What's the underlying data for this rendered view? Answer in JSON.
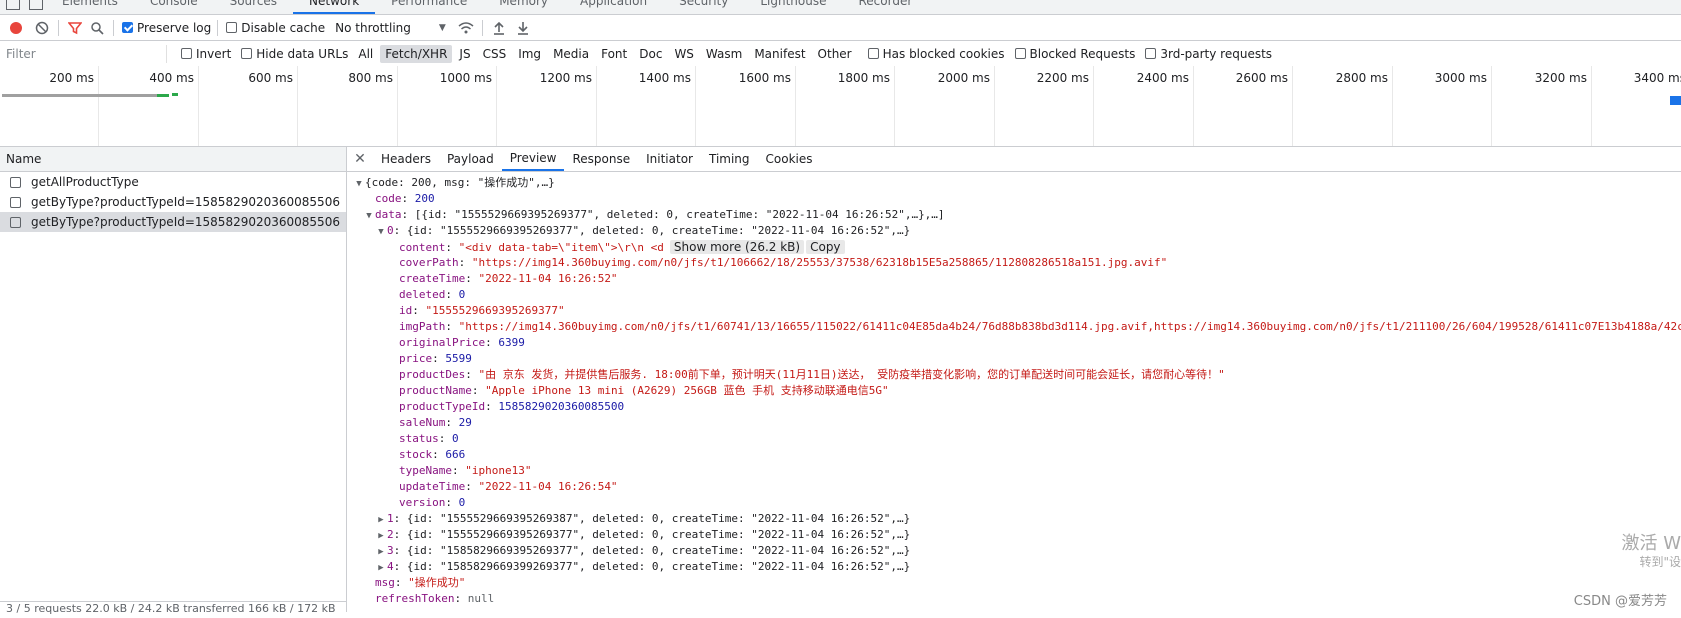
{
  "devtools": {
    "tabs": [
      "Elements",
      "Console",
      "Sources",
      "Network",
      "Performance",
      "Memory",
      "Application",
      "Security",
      "Lighthouse",
      "Recorder"
    ],
    "active_tab": "Network"
  },
  "toolbar": {
    "preserve_log": "Preserve log",
    "disable_cache": "Disable cache",
    "throttling": "No throttling"
  },
  "filter": {
    "placeholder": "Filter",
    "invert": "Invert",
    "hide_data_urls": "Hide data URLs",
    "types": [
      "All",
      "Fetch/XHR",
      "JS",
      "CSS",
      "Img",
      "Media",
      "Font",
      "Doc",
      "WS",
      "Wasm",
      "Manifest",
      "Other"
    ],
    "active_type": "Fetch/XHR",
    "has_blocked_cookies": "Has blocked cookies",
    "blocked_requests": "Blocked Requests",
    "third_party": "3rd-party requests"
  },
  "overview": {
    "ticks": [
      "200 ms",
      "400 ms",
      "600 ms",
      "800 ms",
      "1000 ms",
      "1200 ms",
      "1400 ms",
      "1600 ms",
      "1800 ms",
      "2000 ms",
      "2200 ms",
      "2400 ms",
      "2600 ms",
      "2800 ms",
      "3000 ms",
      "3200 ms",
      "3400 ms"
    ]
  },
  "requests": {
    "header": "Name",
    "items": [
      "getAllProductType",
      "getByType?productTypeId=1585829020360085506",
      "getByType?productTypeId=1585829020360085506"
    ],
    "selected_index": 2,
    "status": "3 / 5 requests   22.0 kB / 24.2 kB transferred   166 kB / 172 kB"
  },
  "detail": {
    "tabs": [
      "Headers",
      "Payload",
      "Preview",
      "Response",
      "Initiator",
      "Timing",
      "Cookies"
    ],
    "active": "Preview",
    "show_more": "Show more (26.2 kB)",
    "copy": "Copy"
  },
  "preview": {
    "root_summary": "{code: 200, msg: \"操作成功\",…}",
    "code_key": "code",
    "code_val": "200",
    "data_key": "data",
    "data_summary": "[{id: \"1555529669395269377\", deleted: 0, createTime: \"2022-11-04 16:26:52\",…},…]",
    "item0_key": "0",
    "item0_summary": "{id: \"1555529669395269377\", deleted: 0, createTime: \"2022-11-04 16:26:52\",…}",
    "fields": [
      {
        "key": "content",
        "val": "\"<div data-tab=\\\"item\\\">\\r\\n                    <d",
        "cls": "s"
      },
      {
        "key": "coverPath",
        "val": "\"https://img14.360buyimg.com/n0/jfs/t1/106662/18/25553/37538/62318b15E5a258865/112808286518a151.jpg.avif\"",
        "cls": "s"
      },
      {
        "key": "createTime",
        "val": "\"2022-11-04 16:26:52\"",
        "cls": "s"
      },
      {
        "key": "deleted",
        "val": "0",
        "cls": "n"
      },
      {
        "key": "id",
        "val": "\"1555529669395269377\"",
        "cls": "s"
      },
      {
        "key": "imgPath",
        "val": "\"https://img14.360buyimg.com/n0/jfs/t1/60741/13/16655/115022/61411c04E85da4b24/76d88b838bd3d114.jpg.avif,https://img14.360buyimg.com/n0/jfs/t1/211100/26/604/199528/61411c07E13b4188a/42c",
        "cls": "s"
      },
      {
        "key": "originalPrice",
        "val": "6399",
        "cls": "n"
      },
      {
        "key": "price",
        "val": "5599",
        "cls": "n"
      },
      {
        "key": "productDes",
        "val": "\"由 京东 发货，并提供售后服务. 18:00前下单，预计明天(11月11日)送达， 受防疫举措变化影响，您的订单配送时间可能会延长，请您耐心等待！\"",
        "cls": "s"
      },
      {
        "key": "productName",
        "val": "\"Apple iPhone 13 mini (A2629) 256GB 蓝色 手机 支持移动联通电信5G\"",
        "cls": "s"
      },
      {
        "key": "productTypeId",
        "val": "1585829020360085500",
        "cls": "n"
      },
      {
        "key": "saleNum",
        "val": "29",
        "cls": "n"
      },
      {
        "key": "status",
        "val": "0",
        "cls": "n"
      },
      {
        "key": "stock",
        "val": "666",
        "cls": "n"
      },
      {
        "key": "typeName",
        "val": "\"iphone13\"",
        "cls": "s"
      },
      {
        "key": "updateTime",
        "val": "\"2022-11-04 16:26:54\"",
        "cls": "s"
      },
      {
        "key": "version",
        "val": "0",
        "cls": "n"
      }
    ],
    "collapsed_items": [
      {
        "key": "1",
        "summary": "{id: \"1555529669395269387\", deleted: 0, createTime: \"2022-11-04 16:26:52\",…}"
      },
      {
        "key": "2",
        "summary": "{id: \"1555529669395269377\", deleted: 0, createTime: \"2022-11-04 16:26:52\",…}"
      },
      {
        "key": "3",
        "summary": "{id: \"1585829669395269377\", deleted: 0, createTime: \"2022-11-04 16:26:52\",…}"
      },
      {
        "key": "4",
        "summary": "{id: \"1585829669399269377\", deleted: 0, createTime: \"2022-11-04 16:26:52\",…}"
      }
    ],
    "msg_key": "msg",
    "msg_val": "\"操作成功\"",
    "refresh_key": "refreshToken",
    "refresh_val": "null"
  },
  "watermarks": {
    "activate": "激活 W",
    "goto": "转到\"设",
    "csdn": "CSDN @爱芳芳"
  }
}
